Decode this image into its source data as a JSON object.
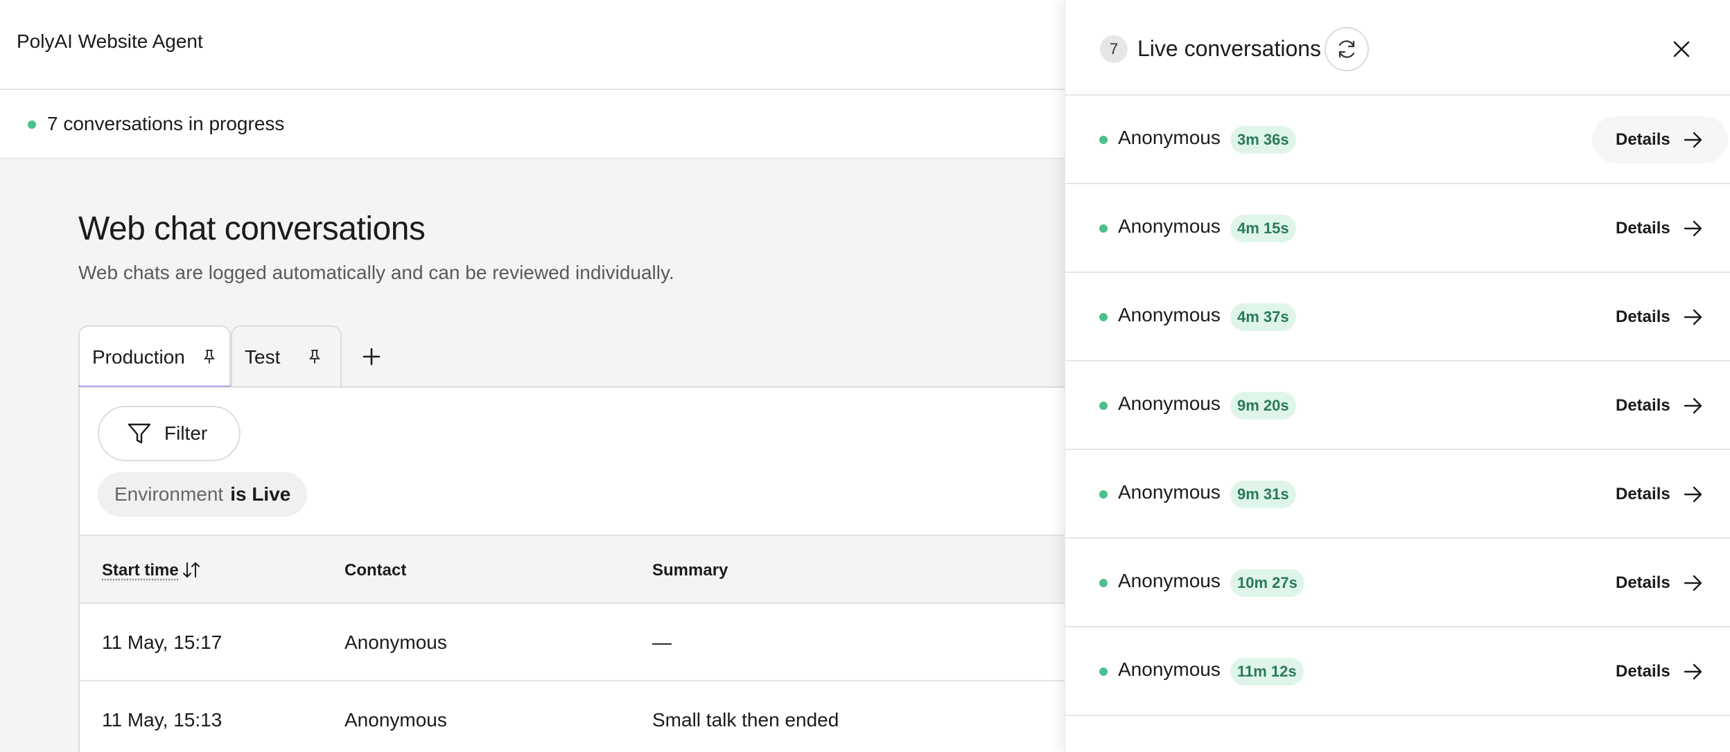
{
  "app": {
    "title": "PolyAI Website Agent"
  },
  "status": {
    "text": "7 conversations in progress",
    "dot_color": "#4cbf8a"
  },
  "page": {
    "title": "Web chat conversations",
    "subtitle": "Web chats are logged automatically and can be reviewed individually."
  },
  "tabs": [
    {
      "label": "Production",
      "active": true
    },
    {
      "label": "Test",
      "active": false
    }
  ],
  "toolbar": {
    "filter_label": "Filter",
    "chip_key": "Environment",
    "chip_value": "is Live"
  },
  "table": {
    "columns": [
      "Start time",
      "Contact",
      "Summary"
    ],
    "rows": [
      {
        "start": "11 May, 15:17",
        "contact": "Anonymous",
        "summary": "—"
      },
      {
        "start": "11 May, 15:13",
        "contact": "Anonymous",
        "summary": "Small talk then ended"
      }
    ]
  },
  "drawer": {
    "count": "7",
    "title": "Live conversations",
    "details_label": "Details",
    "conversations": [
      {
        "name": "Anonymous",
        "duration": "3m 36s"
      },
      {
        "name": "Anonymous",
        "duration": "4m 15s"
      },
      {
        "name": "Anonymous",
        "duration": "4m 37s"
      },
      {
        "name": "Anonymous",
        "duration": "9m 20s"
      },
      {
        "name": "Anonymous",
        "duration": "9m 31s"
      },
      {
        "name": "Anonymous",
        "duration": "10m 27s"
      },
      {
        "name": "Anonymous",
        "duration": "11m 12s"
      }
    ]
  },
  "colors": {
    "accent": "#7b6cf0",
    "live_dot": "#4cbf8a",
    "duration_bg": "#dff5ea",
    "duration_text": "#2a7a55"
  },
  "icons": [
    "pin-icon",
    "plus-icon",
    "filter-icon",
    "sort-icon",
    "refresh-icon",
    "close-icon",
    "arrow-right-icon"
  ]
}
